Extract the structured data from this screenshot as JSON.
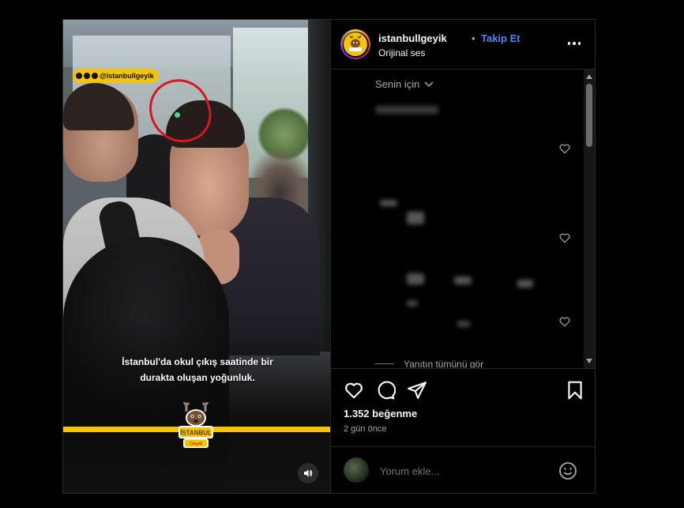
{
  "post": {
    "watermark": "@istanbullgeyik",
    "caption_line1": "İstanbul'da okul çıkış saatinde bir",
    "caption_line2": "durakta oluşan yoğunluk.",
    "logo_text": "İSTANBUL",
    "logo_subtext": "Geyik"
  },
  "header": {
    "username": "istanbullgeyik",
    "separator": "•",
    "follow_label": "Takip Et",
    "audio_label": "Orijinal ses"
  },
  "comments": {
    "sort_label": "Senin için",
    "see_all_label": "Yanıtın tümünü gör"
  },
  "actions": {
    "likes": "1.352 beğenme",
    "date": "2 gün önce"
  },
  "comment_box": {
    "placeholder": "Yorum ekle..."
  },
  "colors": {
    "accent_blue": "#4a88f5",
    "brand_yellow": "#f6c400",
    "annotation_red": "#d9161f"
  },
  "icons": [
    "more-icon",
    "chevron-down-icon",
    "heart-icon",
    "comment-icon",
    "share-icon",
    "bookmark-icon",
    "emoji-icon",
    "sound-icon"
  ]
}
